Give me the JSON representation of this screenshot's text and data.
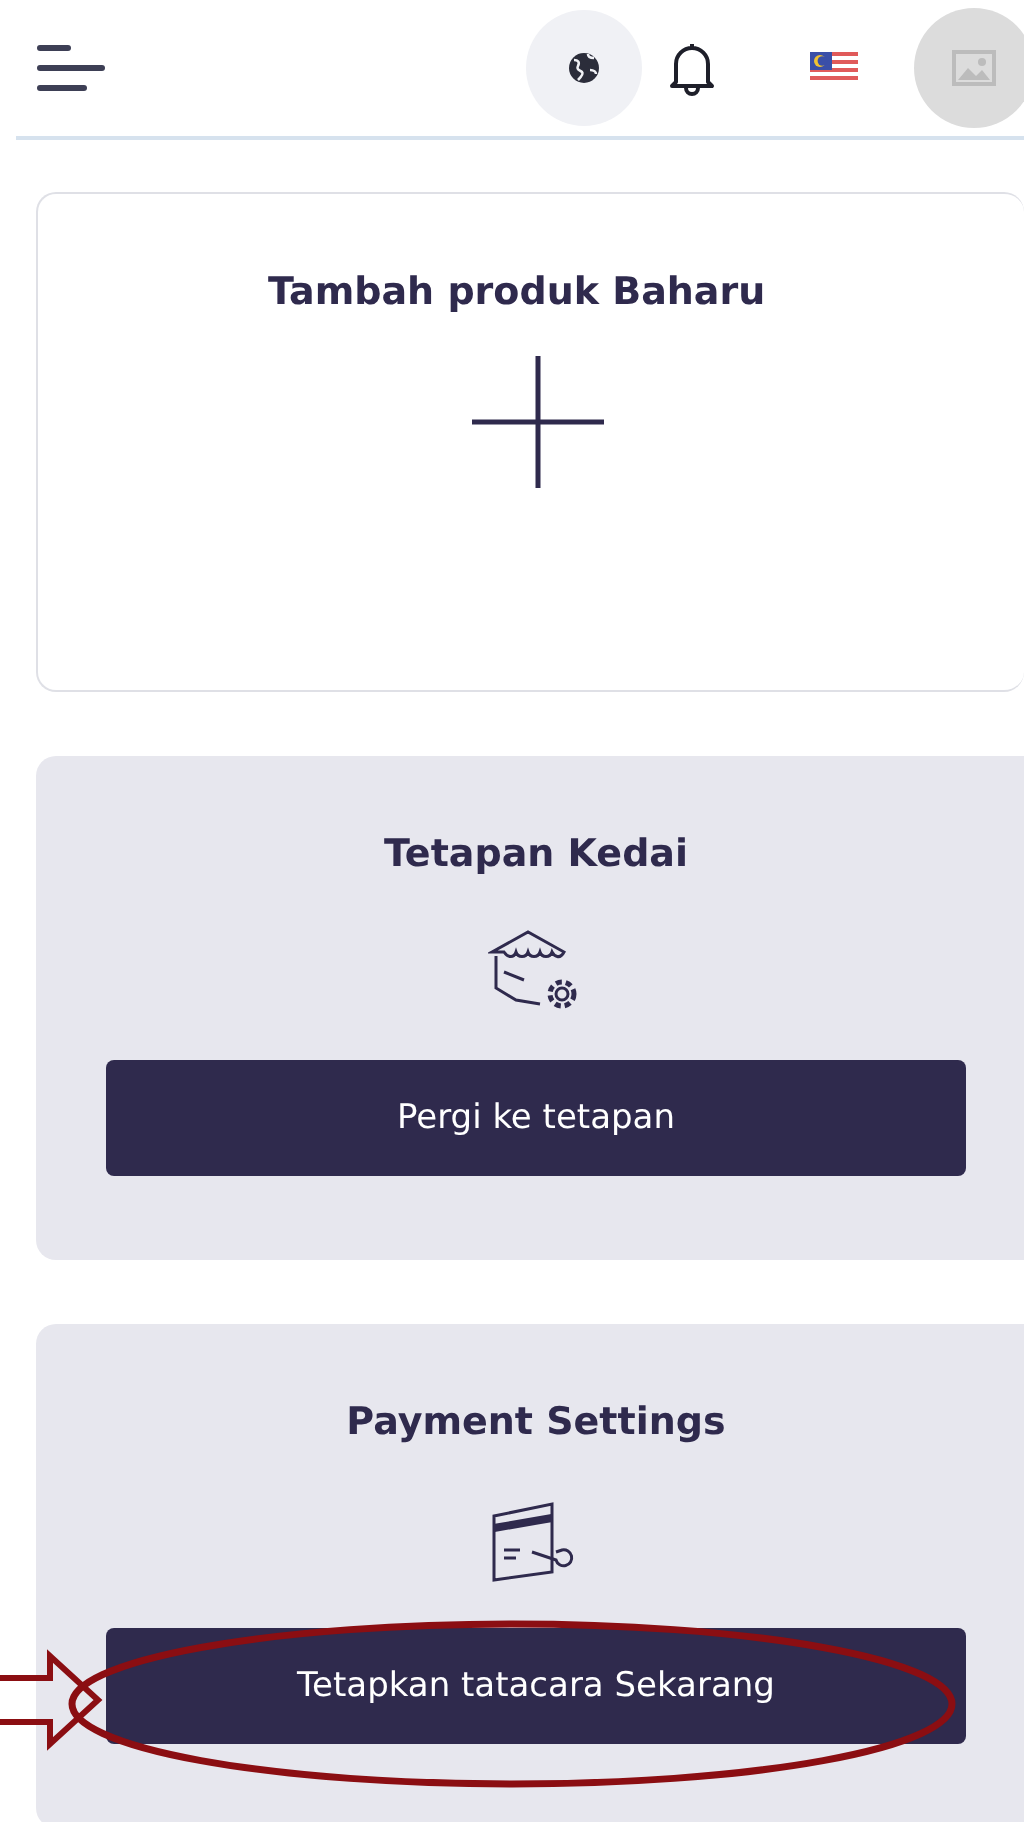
{
  "add_card": {
    "title": "Tambah produk Baharu"
  },
  "settings_cards": [
    {
      "kind": "store",
      "title": "Tetapan Kedai",
      "button": "Pergi ke tetapan",
      "highlighted": false
    },
    {
      "kind": "payment",
      "title": "Payment Settings",
      "button": "Tetapkan tatacara Sekarang",
      "highlighted": true
    }
  ]
}
